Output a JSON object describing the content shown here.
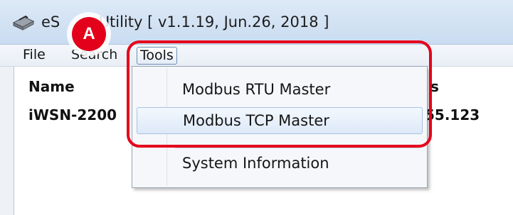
{
  "window": {
    "title_prefix": "eS",
    "title_suffix": "Utility [ v1.1.19, Jun.26, 2018 ]"
  },
  "menubar": {
    "file": "File",
    "search_partial": "Search",
    "tools": "Tools"
  },
  "list": {
    "headers": {
      "name": "Name",
      "ip_partial": "s"
    },
    "rows": [
      {
        "name": "iWSN-2200",
        "ip_partial": "55.123"
      }
    ]
  },
  "tools_menu": {
    "items": [
      "Modbus RTU Master",
      "Modbus TCP Master",
      "System Information"
    ],
    "hovered_index": 1
  },
  "callout": {
    "label": "A",
    "color": "#e3001b"
  },
  "highlight_color": "#e6001c"
}
